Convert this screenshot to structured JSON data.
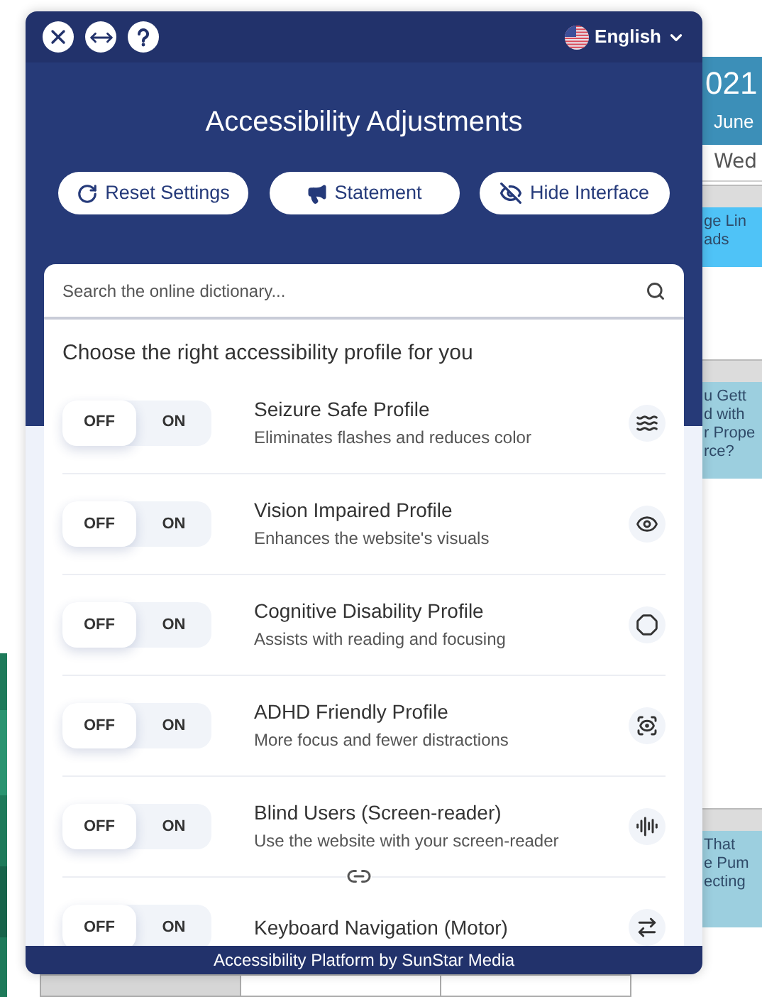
{
  "header": {
    "language": "English"
  },
  "title": "Accessibility Adjustments",
  "actions": [
    {
      "kind": "reset",
      "label": "Reset Settings"
    },
    {
      "kind": "statement",
      "label": "Statement"
    },
    {
      "kind": "hide",
      "label": "Hide Interface"
    }
  ],
  "search": {
    "placeholder": "Search the online dictionary..."
  },
  "profiles_heading": "Choose the right accessibility profile for you",
  "profiles": [
    {
      "kind": "seizure",
      "title": "Seizure Safe Profile",
      "description": "Eliminates flashes and reduces color",
      "off_label": "OFF",
      "on_label": "ON",
      "on": false
    },
    {
      "kind": "vision",
      "title": "Vision Impaired Profile",
      "description": "Enhances the website's visuals",
      "off_label": "OFF",
      "on_label": "ON",
      "on": false
    },
    {
      "kind": "cognitive",
      "title": "Cognitive Disability Profile",
      "description": "Assists with reading and focusing",
      "off_label": "OFF",
      "on_label": "ON",
      "on": false
    },
    {
      "kind": "adhd",
      "title": "ADHD Friendly Profile",
      "description": "More focus and fewer distractions",
      "off_label": "OFF",
      "on_label": "ON",
      "on": false
    },
    {
      "kind": "blind",
      "title": "Blind Users (Screen-reader)",
      "description": "Use the website with your screen-reader",
      "off_label": "OFF",
      "on_label": "ON",
      "on": false
    },
    {
      "kind": "keyboard",
      "title": "Keyboard Navigation (Motor)",
      "off_label": "OFF",
      "on_label": "ON",
      "on": false
    }
  ],
  "footer": "Accessibility Platform by SunStar Media",
  "background_page": {
    "year": "021",
    "month": "June",
    "weekday": "Wed",
    "events": [
      {
        "kind": "bright",
        "lines": [
          "ge Lin",
          "ads"
        ]
      },
      {
        "kind": "muted",
        "lines": [
          "u Gett",
          "d with",
          "r Prope",
          "rce?"
        ]
      },
      {
        "kind": "muted",
        "lines": [
          "That",
          "e Pum",
          "ecting"
        ]
      }
    ]
  }
}
